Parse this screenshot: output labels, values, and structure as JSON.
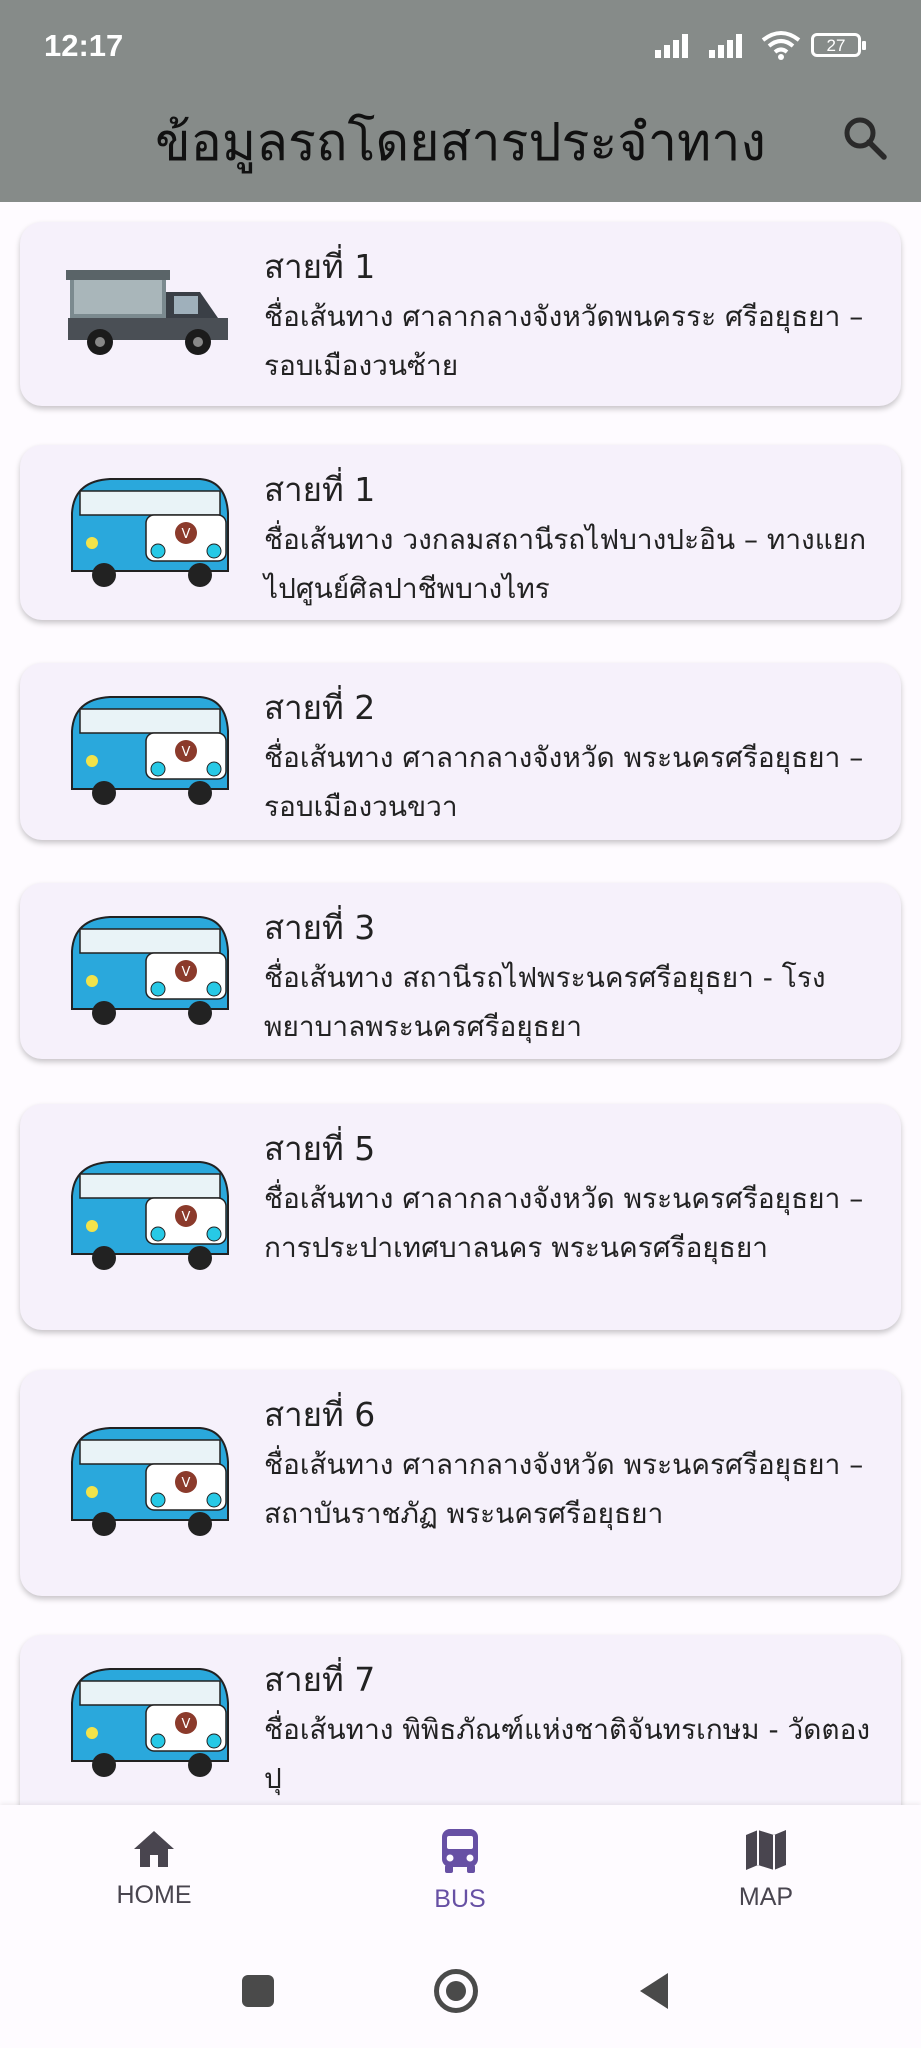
{
  "status": {
    "time": "12:17",
    "battery": "27"
  },
  "header": {
    "title": "ข้อมูลรถโดยสารประจำทาง"
  },
  "routes": [
    {
      "number": "สายที่ 1",
      "name": "ชื่อเส้นทาง ศาลากลางจังหวัดพนครระ ศรีอยุธยา – รอบเมืองวนซ้าย",
      "image": "songthaew-truck"
    },
    {
      "number": "สายที่ 1",
      "name": "ชื่อเส้นทาง วงกลมสถานีรถไฟบางปะอิน – ทางแยกไปศูนย์ศิลปาชีพบางไทร",
      "image": "cartoon-van"
    },
    {
      "number": "สายที่ 2",
      "name": "ชื่อเส้นทาง ศาลากลางจังหวัด พระนครศรีอยุธยา – รอบเมืองวนขวา",
      "image": "cartoon-van"
    },
    {
      "number": "สายที่ 3",
      "name": "ชื่อเส้นทาง สถานีรถไฟพระนครศรีอยุธยา - โรงพยาบาลพระนครศรีอยุธยา",
      "image": "cartoon-van"
    },
    {
      "number": "สายที่ 5",
      "name": "ชื่อเส้นทาง ศาลากลางจังหวัด พระนครศรีอยุธยา – การประปาเทศบาลนคร พระนครศรีอยุธยา",
      "image": "cartoon-van"
    },
    {
      "number": "สายที่ 6",
      "name": "ชื่อเส้นทาง ศาลากลางจังหวัด พระนครศรีอยุธยา – สถาบันราชภัฏ พระนครศรีอยุธยา",
      "image": "cartoon-van"
    },
    {
      "number": "สายที่ 7",
      "name": "ชื่อเส้นทาง พิพิธภัณฑ์แห่งชาติจันทรเกษม - วัดตองปุ",
      "image": "cartoon-van"
    }
  ],
  "nav": {
    "home": {
      "label": "HOME",
      "icon": "home-icon"
    },
    "bus": {
      "label": "BUS",
      "icon": "bus-icon",
      "active": true
    },
    "map": {
      "label": "MAP",
      "icon": "map-icon"
    }
  },
  "colors": {
    "header_bg": "#868b89",
    "accent": "#6750a4",
    "card_bg": "#f6f1fb"
  }
}
